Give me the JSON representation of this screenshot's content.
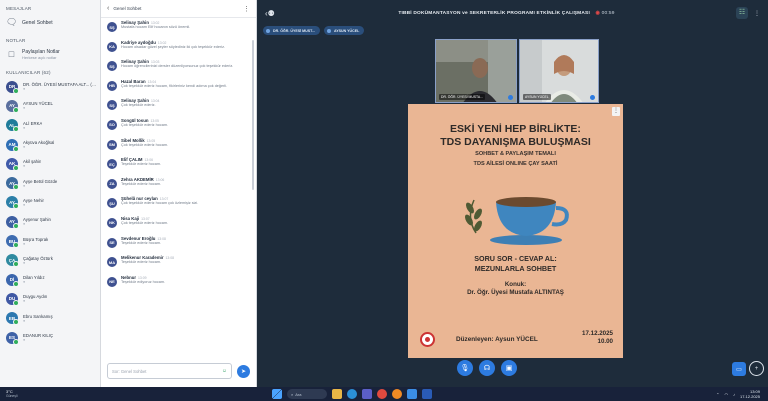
{
  "left_panel": {
    "section_meetings": "MESAJLAR",
    "general_chat": "Genel Sohbet",
    "section_notes": "NOTLAR",
    "shared_notes": "Paylaşılan Notlar",
    "shared_notes_sub": "Herkese açık notlar",
    "section_users": "KULLANICILAR (62)",
    "participants": [
      {
        "initials": "DR",
        "name": "DR. ÖĞR. ÜYESİ MUSTAFA ALT... (Sen)",
        "color": "#3b4f8f"
      },
      {
        "initials": "AY",
        "name": "AYSUN YÜCEL",
        "color": "#5a6f9e"
      },
      {
        "initials": "AL",
        "name": "ALİ ERKA",
        "color": "#1f7c9a"
      },
      {
        "initials": "AM",
        "name": "Akyüva Akoğlsal",
        "color": "#2f6fb5"
      },
      {
        "initials": "AK",
        "name": "Akil şahin",
        "color": "#3f5aa9"
      },
      {
        "initials": "AY",
        "name": "Ayşe Betül Gözde",
        "color": "#3c6b9e"
      },
      {
        "initials": "AY",
        "name": "Ayşe Nehir",
        "color": "#2b7fa8"
      },
      {
        "initials": "AY",
        "name": "Ayşenur Şahin",
        "color": "#3d5fa2"
      },
      {
        "initials": "BU",
        "name": "Büşra Toprak",
        "color": "#3e6cb0"
      },
      {
        "initials": "ÇA",
        "name": "Çağatay Öztürk",
        "color": "#2f8aa0"
      },
      {
        "initials": "Dİ",
        "name": "Dilan Yıldız",
        "color": "#3b66ad"
      },
      {
        "initials": "DU",
        "name": "Duygu Aydın",
        "color": "#3f58a4"
      },
      {
        "initials": "EB",
        "name": "Ebru Sarıkamış",
        "color": "#2c78b0"
      },
      {
        "initials": "ES",
        "name": "EDANUR KILIÇ",
        "color": "#3e62a7"
      }
    ]
  },
  "chat": {
    "header": "Genel Sohbet",
    "input_placeholder": "Sor: Genel Sohbet",
    "messages": [
      {
        "initials": "SŞ",
        "name": "Selinay Şahin",
        "time": "13:02",
        "text": "Mustafa hocam Elif hocanın sözü önemli."
      },
      {
        "initials": "KA",
        "name": "Kadriye aydoğdu",
        "time": "13:02",
        "text": "Hocam olsadar güzel şeyler söylediniz iki çok teşekkür ederiz."
      },
      {
        "initials": "SŞ",
        "name": "Selinay Şahin",
        "time": "13:03",
        "text": "Hocam öğrencilerinizi dersler düzenliyorsunuz çok teşekkür ederiz."
      },
      {
        "initials": "HB",
        "name": "Hazal Baran",
        "time": "13:04",
        "text": "Çok teşekkür ederiz hocam, fikirleriniz kendi adıma çok değerli."
      },
      {
        "initials": "SŞ",
        "name": "Selinay Şahin",
        "time": "13:04",
        "text": "Çok teşekkür ederiz."
      },
      {
        "initials": "SO",
        "name": "Songül tosun",
        "time": "13:05",
        "text": "Çok teşekkür ederiz hocam."
      },
      {
        "initials": "SM",
        "name": "Sibel Mollik",
        "time": "13:05",
        "text": "Çok teşekkür ederiz hocam."
      },
      {
        "initials": "EÇ",
        "name": "Elif ÇALIM",
        "time": "13:06",
        "text": "Teşekkür ederiz hocam."
      },
      {
        "initials": "ZA",
        "name": "Zehra AKDEMİR",
        "time": "13:06",
        "text": "Teşekkür ederiz hocam."
      },
      {
        "initials": "ŞU",
        "name": "Şühelâ nur ceylan",
        "time": "13:07",
        "text": "Çok teşekkür ederiz hocam çok özlemişiz sizi."
      },
      {
        "initials": "NK",
        "name": "Nisa Kaji",
        "time": "13:07",
        "text": "Çok teşekkür ederiz hocam."
      },
      {
        "initials": "SE",
        "name": "Sevdenur Eroğlu",
        "time": "13:08",
        "text": "Teşekkür ederiz hocam."
      },
      {
        "initials": "MA",
        "name": "Melikenur Karademir",
        "time": "13:08",
        "text": "Teşekkür ederiz hocam."
      },
      {
        "initials": "NE",
        "name": "Nebnur",
        "time": "13:09",
        "text": "Teşekkür ediyoruz hocam."
      }
    ]
  },
  "meeting": {
    "title": "TIBBİ DOKÜMANTASYON ve SEKRETERLİK PROGRAMI ETKİNLİK ÇALIŞMASI",
    "rec_label": "00:59",
    "pills": [
      "DR. ÖĞR. ÜYESİ MUST...",
      "AYSUN YÜCEL"
    ],
    "videos": [
      {
        "label": "DR. ÖĞR. ÜYESİ MUSTA..."
      },
      {
        "label": "AYSUN YÜCEL"
      }
    ]
  },
  "poster": {
    "title_line1": "ESKİ YENİ HEP BİRLİKTE:",
    "title_line2": "TDS DAYANIŞMA BULUŞMASI",
    "subtitle_line1": "SOHBET & PAYLAŞIM TEMALI",
    "subtitle_line2": "TDS AİLESİ ONLINE ÇAY SAATİ",
    "qa_line1": "SORU SOR - CEVAP AL:",
    "qa_line2": "MEZUNLARLA SOHBET",
    "guest_label": "Konuk:",
    "guest_name": "Dr. Öğr. Üyesi Mustafa ALTINTAŞ",
    "organizer": "Düzenleyen: Aysun YÜCEL",
    "date": "17.12.2025",
    "time": "10.00"
  },
  "taskbar": {
    "weather_temp": "3°C",
    "weather_desc": "Güneşli",
    "search": "Ara",
    "clock_time": "13:09",
    "clock_date": "17.12.2025"
  }
}
